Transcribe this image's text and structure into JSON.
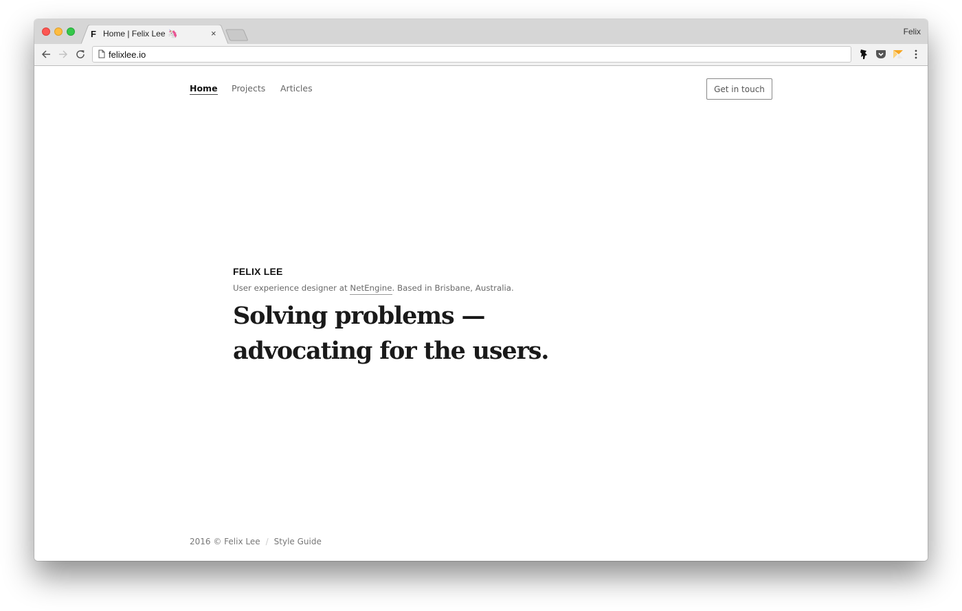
{
  "browser": {
    "tab": {
      "favicon": "F",
      "title": "Home | Felix Lee 🦄",
      "close_glyph": "×"
    },
    "profile_name": "Felix",
    "address_bar": {
      "url": "felixlee.io",
      "page_icon": "document-icon"
    },
    "nav_buttons": [
      "back-icon",
      "forward-icon",
      "reload-icon"
    ],
    "extensions": [
      "ninja-extension-icon",
      "pocket-icon",
      "highlighter-extension-icon",
      "menu-kebab-icon"
    ],
    "colors": {
      "close": "#fc5753",
      "minimize": "#fdbc40",
      "maximize": "#34c84a",
      "pocket": "#555555",
      "highlighter": "#f6a623"
    }
  },
  "site": {
    "nav": {
      "items": [
        {
          "label": "Home",
          "active": true
        },
        {
          "label": "Projects",
          "active": false
        },
        {
          "label": "Articles",
          "active": false
        }
      ],
      "cta_label": "Get in touch"
    },
    "hero": {
      "name": "FELIX LEE",
      "subtitle_prefix": "User experience designer at ",
      "subtitle_link": "NetEngine",
      "subtitle_suffix": ". Based in Brisbane, Australia.",
      "headline_line1": "Solving problems —",
      "headline_line2": "advocating for the users."
    },
    "footer": {
      "copyright": "2016 © Felix Lee",
      "separator": "/",
      "link": "Style Guide"
    }
  }
}
